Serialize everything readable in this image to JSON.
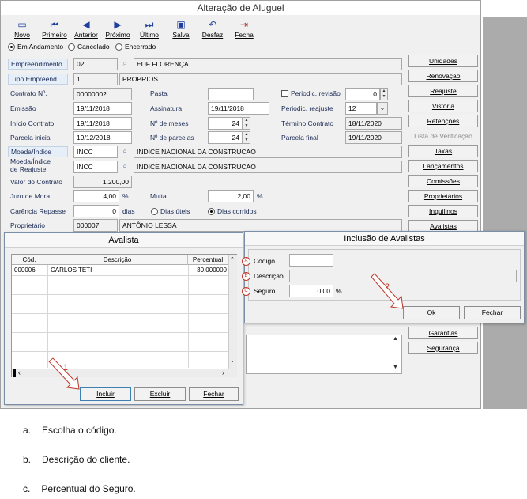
{
  "window": {
    "title": "Alteração de Aluguel"
  },
  "toolbar": {
    "novo": "Novo",
    "primeiro": "Primeiro",
    "anterior": "Anterior",
    "proximo": "Próximo",
    "ultimo": "Último",
    "salva": "Salva",
    "desfaz": "Desfaz",
    "fecha": "Fecha"
  },
  "status": {
    "em_andamento": "Em Andamento",
    "cancelado": "Cancelado",
    "encerrado": "Encerrado",
    "selected": "Em Andamento"
  },
  "form": {
    "empreendimento_label": "Empreendimento",
    "empreendimento_code": "02",
    "empreendimento_name": "EDF FLORENÇA",
    "tipo_label": "Tipo Empreend.",
    "tipo_code": "1",
    "tipo_name": "PROPRIOS",
    "contrato_label": "Contrato Nº.",
    "contrato_value": "00000002",
    "pasta_label": "Pasta",
    "pasta_value": "",
    "periodic_revisao_label": "Periodic. revisão",
    "periodic_revisao_value": "0",
    "emissao_label": "Emissão",
    "emissao_value": "19/11/2018",
    "assinatura_label": "Assinatura",
    "assinatura_value": "19/11/2018",
    "periodic_reajuste_label": "Periodic. reajuste",
    "periodic_reajuste_value": "12",
    "inicio_label": "Início Contrato",
    "inicio_value": "19/11/2018",
    "meses_label": "Nº de meses",
    "meses_value": "24",
    "termino_label": "Término Contrato",
    "termino_value": "18/11/2020",
    "parcela_inicial_label": "Parcela inicial",
    "parcela_inicial_value": "19/12/2018",
    "parcelas_label": "Nº de parcelas",
    "parcelas_value": "24",
    "parcela_final_label": "Parcela final",
    "parcela_final_value": "19/11/2020",
    "moeda_label": "Moeda/Índice",
    "moeda_code": "INCC",
    "moeda_name": "INDICE NACIONAL DA CONSTRUCAO",
    "moeda_reajuste_label1": "Moeda/Índice",
    "moeda_reajuste_label2": "de Reajuste",
    "moeda_reajuste_code": "INCC",
    "moeda_reajuste_name": "INDICE NACIONAL DA CONSTRUCAO",
    "valor_label": "Valor do Contrato",
    "valor_value": "1.200,00",
    "juro_label": "Juro de Mora",
    "juro_value": "4,00",
    "pct": "%",
    "multa_label": "Multa",
    "multa_value": "2,00",
    "carencia_label": "Carência Repasse",
    "carencia_value": "0",
    "dias": "dias",
    "dias_uteis": "Dias úteis",
    "dias_corridos": "Dias corridos",
    "proprietario_label": "Proprietário",
    "proprietario_code": "000007",
    "proprietario_name": "ANTÔNIO LESSA"
  },
  "side_buttons": [
    "Unidades",
    "Renovação",
    "Reajuste",
    "Vistoria",
    "Retenções",
    "Lista de Verificação",
    "Taxas",
    "Lançamentos",
    "Comissões",
    "Proprietários",
    "Inquilinos",
    "Avalistas"
  ],
  "side_buttons_lower": [
    "Garantias",
    "Segurança"
  ],
  "avalista": {
    "title": "Avalista",
    "col_cod": "Cód.",
    "col_descricao": "Descrição",
    "col_percentual": "Percentual",
    "rows": [
      {
        "cod": "000006",
        "descricao": "CARLOS TETI",
        "percentual": "30,000000"
      }
    ],
    "incluir": "Incluir",
    "excluir": "Excluir",
    "fechar": "Fechar"
  },
  "inclusao": {
    "title": "Inclusão de Avalistas",
    "codigo_label": "Código",
    "codigo_value": "",
    "descricao_label": "Descrição",
    "descricao_value": "",
    "seguro_label": "Seguro",
    "seguro_value": "0,00",
    "pct": "%",
    "ok": "Ok",
    "fechar": "Fechar"
  },
  "markers": {
    "a": "A",
    "b": "B",
    "c": "C",
    "one": "1",
    "two": "2"
  },
  "captions": [
    {
      "letter": "a.",
      "text": "Escolha o código."
    },
    {
      "letter": "b.",
      "text": "Descrição do cliente."
    },
    {
      "letter": "c.",
      "text": "Percentual do Seguro."
    }
  ],
  "colors": {
    "accent": "#1f3fa0",
    "annotation": "#c0392b",
    "label_bg": "#e6eef8"
  }
}
